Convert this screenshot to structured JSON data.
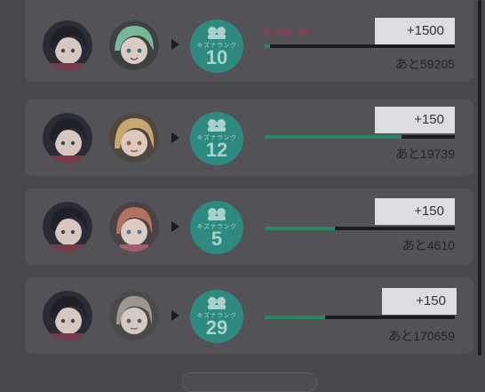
{
  "cards": [
    {
      "rank_up": "RANK UP!",
      "badge_caption": "キズナランク",
      "badge_rank": "10",
      "gain": "+1500",
      "remaining": "あと59205",
      "progress_fraction": 0.03,
      "partner_hair_color": "#78b89a",
      "partner_eye_color": "#2f7b77"
    },
    {
      "rank_up": "",
      "badge_caption": "キズナランク",
      "badge_rank": "12",
      "gain": "+150",
      "remaining": "あと19739",
      "progress_fraction": 0.72,
      "partner_hair_color": "#c8a66f",
      "partner_eye_color": "#8b6436"
    },
    {
      "rank_up": "",
      "badge_caption": "キズナランク",
      "badge_rank": "5",
      "gain": "+150",
      "remaining": "あと4610",
      "progress_fraction": 0.37,
      "partner_hair_color": "#b3725f",
      "partner_eye_color": "#547a93"
    },
    {
      "rank_up": "",
      "badge_caption": "キズナランク",
      "badge_rank": "29",
      "gain": "+150",
      "remaining": "あと170659",
      "progress_fraction": 0.32,
      "partner_hair_color": "#9b9690",
      "partner_eye_color": "#63605a"
    }
  ],
  "colors": {
    "overlay_background": "#47474c",
    "card_background": "#525257",
    "badge": "#2e8a80",
    "progress_fill": "#2a8660",
    "rank_up": "#9c3650"
  },
  "icons": {
    "arrow": "play-triangle-icon",
    "badge_emblem": "bond-rank-icon"
  }
}
